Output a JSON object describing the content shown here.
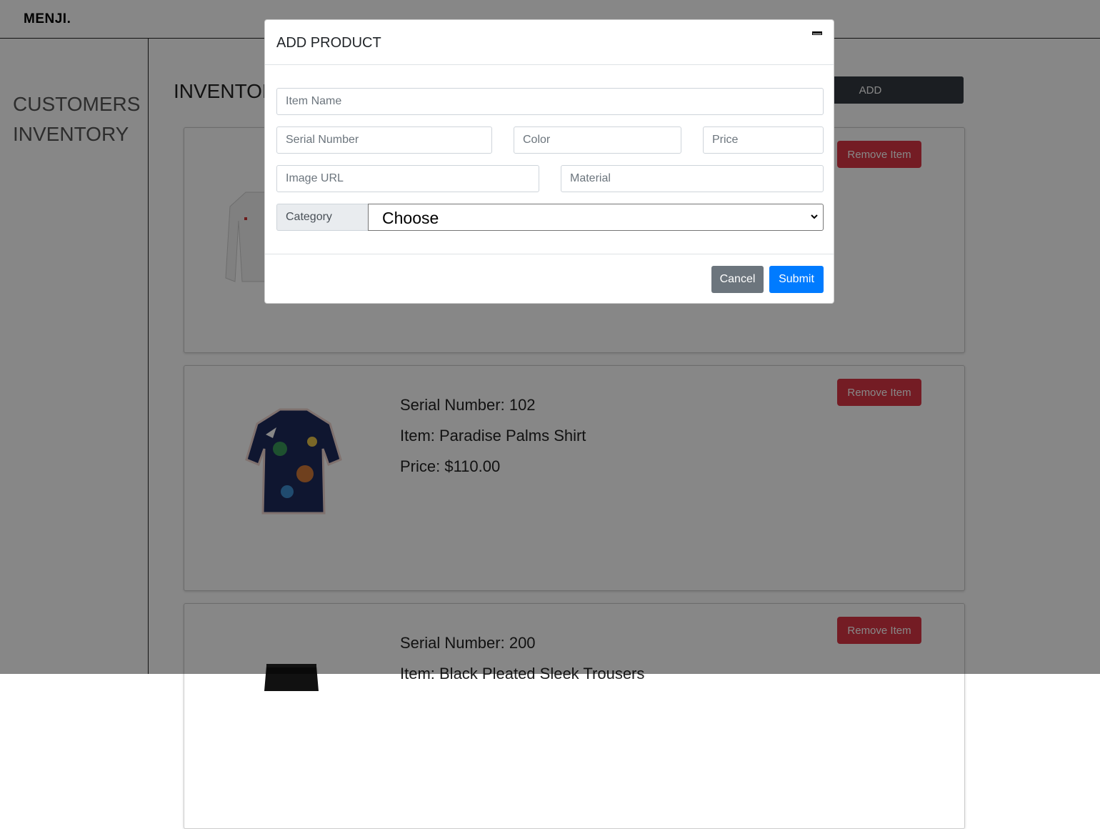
{
  "navbar": {
    "brand": "MENJI."
  },
  "sidebar": {
    "items": [
      {
        "label": "CUSTOMERS"
      },
      {
        "label": "INVENTORY"
      }
    ]
  },
  "main": {
    "title": "INVENTORY",
    "add_label": "ADD",
    "products": [
      {
        "remove_label": "Remove Item",
        "serial": "",
        "item": "",
        "price": "",
        "image_icon": "white-jacket-image"
      },
      {
        "remove_label": "Remove Item",
        "serial": "Serial Number: 102",
        "item": "Item: Paradise Palms Shirt",
        "price": "Price: $110.00",
        "image_icon": "patterned-shirt-image"
      },
      {
        "remove_label": "Remove Item",
        "serial": "Serial Number: 200",
        "item": "Item: Black Pleated Sleek Trousers",
        "price": "",
        "image_icon": "black-trousers-image"
      }
    ]
  },
  "modal": {
    "title": "ADD PRODUCT",
    "fields": {
      "item_name": {
        "placeholder": "Item Name",
        "value": ""
      },
      "serial_number": {
        "placeholder": "Serial Number",
        "value": ""
      },
      "color": {
        "placeholder": "Color",
        "value": ""
      },
      "price": {
        "placeholder": "Price",
        "value": ""
      },
      "image_url": {
        "placeholder": "Image URL",
        "value": ""
      },
      "material": {
        "placeholder": "Material",
        "value": ""
      }
    },
    "category": {
      "label": "Category",
      "selected": "Choose"
    },
    "cancel_label": "Cancel",
    "submit_label": "Submit"
  },
  "colors": {
    "primary": "#007bff",
    "danger": "#dc3545",
    "secondary": "#6c757d",
    "dark": "#343a40",
    "overlay": "rgba(0,0,0,0.47)"
  }
}
